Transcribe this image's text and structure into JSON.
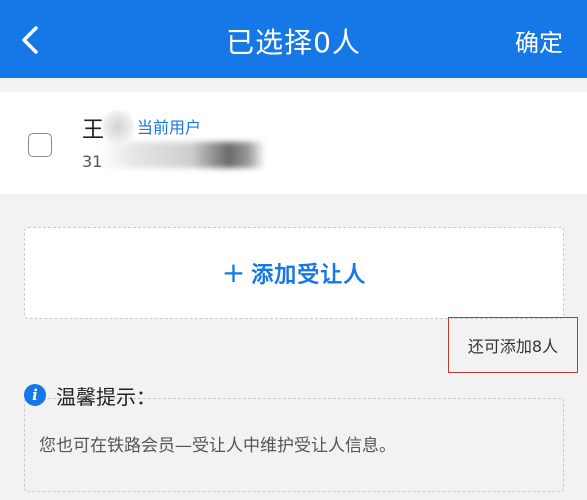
{
  "header": {
    "title": "已选择0人",
    "confirm_label": "确定",
    "back_icon": "chevron-left-icon",
    "bg_color": "#1677e6"
  },
  "user": {
    "name": "王",
    "tag": "当前用户",
    "id_prefix": "31",
    "checked": false
  },
  "add": {
    "plus": "+",
    "label": "添加受让人"
  },
  "remaining": {
    "text": "还可添加8人"
  },
  "tips": {
    "icon": "info-icon",
    "title": "温馨提示：",
    "text": "您也可在铁路会员—受让人中维护受让人信息。"
  }
}
